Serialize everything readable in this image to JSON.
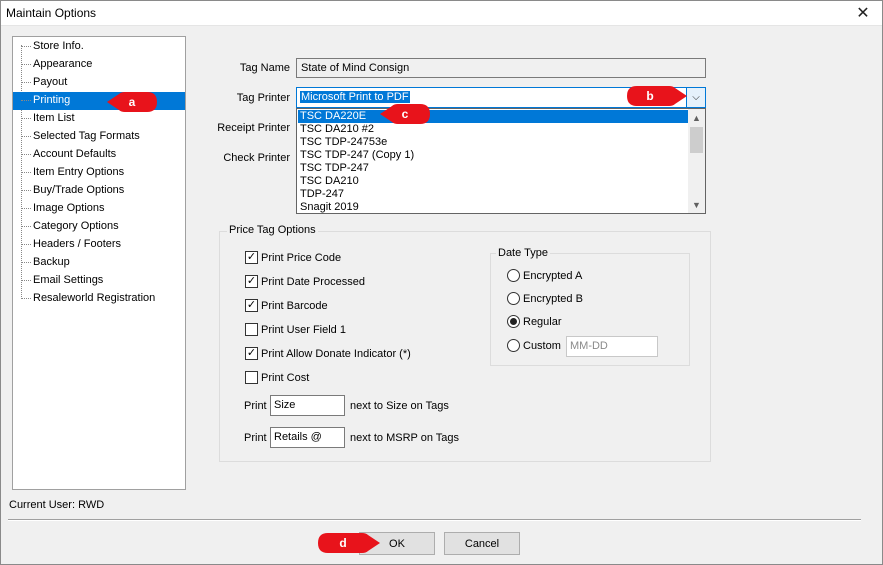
{
  "window": {
    "title": "Maintain Options",
    "close_glyph": "✕"
  },
  "tree": {
    "items": [
      {
        "label": "Store Info."
      },
      {
        "label": "Appearance"
      },
      {
        "label": "Payout"
      },
      {
        "label": "Printing"
      },
      {
        "label": "Item List"
      },
      {
        "label": "Selected Tag Formats"
      },
      {
        "label": "Account Defaults"
      },
      {
        "label": "Item Entry Options"
      },
      {
        "label": "Buy/Trade Options"
      },
      {
        "label": "Image Options"
      },
      {
        "label": "Category Options"
      },
      {
        "label": "Headers / Footers"
      },
      {
        "label": "Backup"
      },
      {
        "label": "Email Settings"
      },
      {
        "label": "Resaleworld Registration"
      }
    ],
    "selected": "Printing"
  },
  "current_user": "Current User: RWD",
  "form": {
    "tag_name_label": "Tag Name",
    "tag_name_value": "State of Mind Consign",
    "tag_printer_label": "Tag Printer",
    "tag_printer_value": "Microsoft Print to PDF",
    "receipt_printer_label": "Receipt Printer",
    "check_printer_label": "Check Printer"
  },
  "dropdown": {
    "options": [
      "TSC DA220E",
      "TSC DA210 #2",
      "TSC TDP-24753e",
      "TSC TDP-247 (Copy 1)",
      "TSC TDP-247",
      "TSC DA210",
      "TDP-247",
      "Snagit 2019"
    ],
    "highlighted": "TSC DA220E",
    "scroll_up_glyph": "▲",
    "scroll_down_glyph": "▼",
    "arrow_glyph": "⌵"
  },
  "price_tag_options": {
    "title": "Price Tag Options",
    "checkboxes": [
      {
        "label": "Print Price Code",
        "checked": true
      },
      {
        "label": "Print Date Processed",
        "checked": true
      },
      {
        "label": "Print Barcode",
        "checked": true
      },
      {
        "label": "Print User Field 1",
        "checked": false
      },
      {
        "label": "Print Allow Donate Indicator (*)",
        "checked": true
      },
      {
        "label": "Print Cost",
        "checked": false
      }
    ],
    "check_glyph": "✓",
    "print_label": "Print",
    "size_value": "Size",
    "size_suffix": "next to Size on Tags",
    "retail_value": "Retails @",
    "retail_suffix": "next to MSRP on Tags"
  },
  "date_type": {
    "title": "Date Type",
    "options": [
      "Encrypted A",
      "Encrypted B",
      "Regular",
      "Custom"
    ],
    "selected": "Regular",
    "custom_placeholder": "MM-DD"
  },
  "buttons": {
    "ok": "OK",
    "cancel": "Cancel"
  },
  "callouts": {
    "a": "a",
    "b": "b",
    "c": "c",
    "d": "d",
    "color": "#e8131b"
  }
}
